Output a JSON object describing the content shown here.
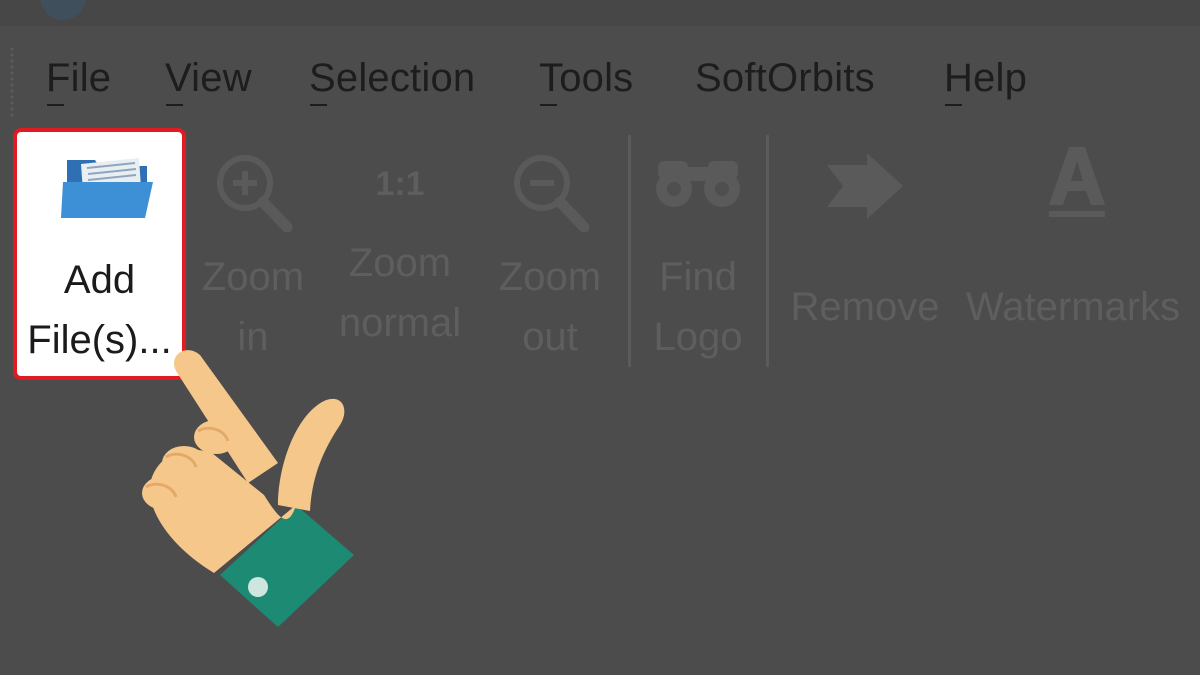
{
  "menu": {
    "items": [
      {
        "label": "File"
      },
      {
        "label": "View"
      },
      {
        "label": "Selection"
      },
      {
        "label": "Tools"
      },
      {
        "label": "SoftOrbits"
      },
      {
        "label": "Help"
      }
    ]
  },
  "toolbar": {
    "add_files": {
      "line1": "Add",
      "line2": "File(s)...",
      "icon": "open-folder-icon"
    },
    "zoom_in": {
      "line1": "Zoom",
      "line2": "in",
      "icon": "zoom-in-icon"
    },
    "zoom_normal": {
      "line1": "Zoom",
      "line2": "normal",
      "icon_text": "1:1",
      "icon": "zoom-normal-icon"
    },
    "zoom_out": {
      "line1": "Zoom",
      "line2": "out",
      "icon": "zoom-out-icon"
    },
    "find_logo": {
      "line1": "Find",
      "line2": "Logo",
      "icon": "binoculars-icon"
    },
    "remove": {
      "label": "Remove",
      "icon": "arrow-forward-icon"
    },
    "watermarks": {
      "label": "Watermarks",
      "icon": "text-a-icon"
    }
  },
  "colors": {
    "overlay_background": "#4c4c4c",
    "highlight_border": "#e01b24",
    "folder_blue": "#3d8fd6",
    "hand_skin": "#f6c78b",
    "cuff_green": "#1d8a74"
  },
  "overlay": {
    "pointer": "pointing-hand-icon"
  }
}
